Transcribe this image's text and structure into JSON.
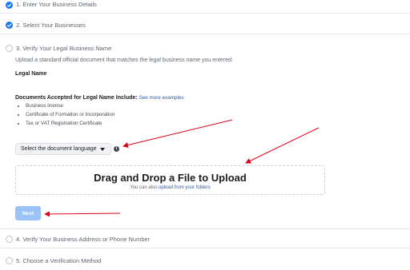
{
  "steps": {
    "s1": {
      "label": "1. Enter Your Business Details",
      "status": "complete"
    },
    "s2": {
      "label": "2. Select Your Businesses",
      "status": "complete"
    },
    "s3": {
      "label": "3. Verify Your Legal Business Name",
      "status": "active"
    },
    "s4": {
      "label": "4. Verify Your Business Address or Phone Number",
      "status": "pending"
    },
    "s5": {
      "label": "5. Choose a Verification Method",
      "status": "pending"
    }
  },
  "main": {
    "instructions": "Upload a standard official document that matches the legal business name you entered:",
    "legal_name_label": "Legal Name",
    "docs_accepted_prefix": "Documents Accepted for Legal Name Include:",
    "see_more_link": "See more examples",
    "docs": [
      "Business license",
      "Certificate of Formation or Incorporation",
      "Tax or VAT Registration Certificate"
    ],
    "language_select": "Select the document language",
    "dropzone_title": "Drag and Drop a File to Upload",
    "dropzone_sub_prefix": "You can also",
    "dropzone_sub_link": "upload from your folders",
    "next_button": "Next"
  },
  "colors": {
    "accent": "#1877f2",
    "next_disabled": "#9cc3f7",
    "arrow": "#d9001b"
  }
}
